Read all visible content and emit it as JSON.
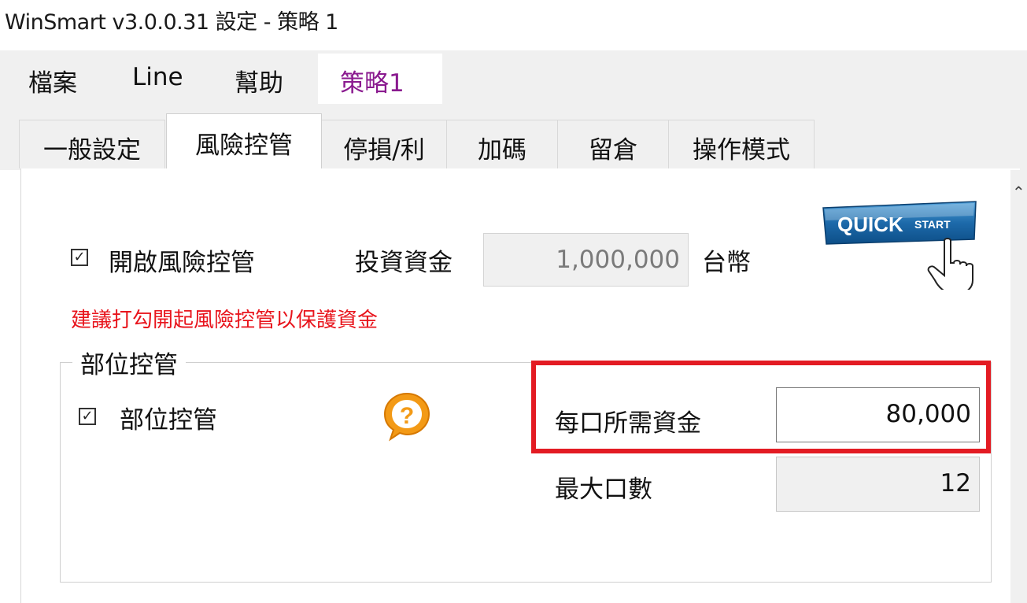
{
  "window": {
    "title": "WinSmart v3.0.0.31 設定 - 策略 1"
  },
  "menu": {
    "items": [
      "檔案",
      "Line",
      "幫助"
    ],
    "active": "策略1"
  },
  "tabs": [
    "一般設定",
    "風險控管",
    "停損/利",
    "加碼",
    "留倉",
    "操作模式"
  ],
  "selected_tab": "風險控管",
  "risk": {
    "enable_label": "開啟風險控管",
    "enable_checked": true,
    "capital_label": "投資資金",
    "capital_value": "1,000,000",
    "currency": "台幣",
    "warning": "建議打勾開起風險控管以保護資金"
  },
  "quick_start": {
    "word1": "QUICK",
    "word2": "START"
  },
  "position": {
    "group_title": "部位控管",
    "checkbox_label": "部位控管",
    "checked": true,
    "margin_label": "每口所需資金",
    "margin_value": "80,000",
    "max_label": "最大口數",
    "max_value": "12"
  },
  "colors": {
    "highlight": "#e31b23",
    "warning": "#e8141c",
    "active_menu": "#8a1a8f"
  }
}
